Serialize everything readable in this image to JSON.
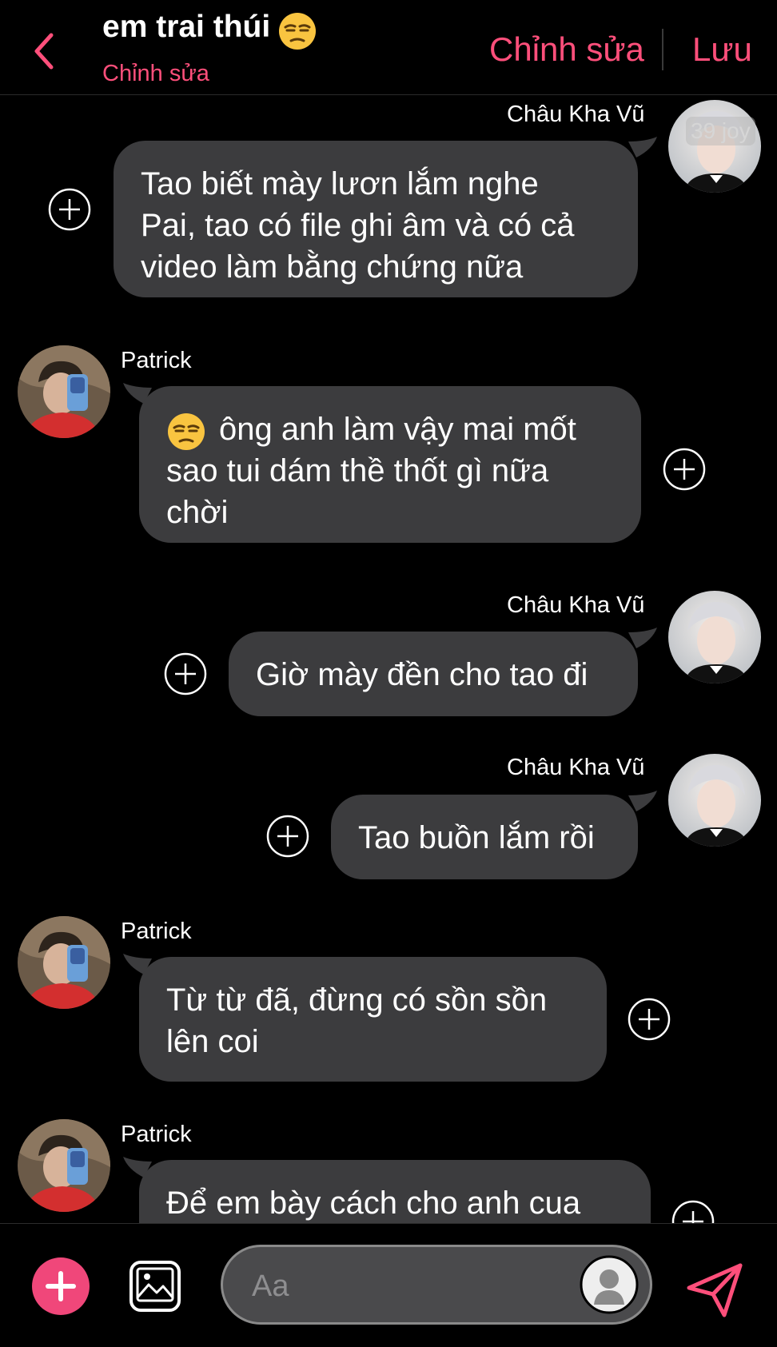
{
  "header": {
    "title": "em trai thúi",
    "subtitle": "Chỉnh sửa",
    "edit_label": "Chỉnh sửa",
    "save_label": "Lưu"
  },
  "watermark": "39 joy",
  "messages": [
    {
      "sender": "Châu Kha Vũ",
      "text": "Tao biết mày lươn lắm nghe\nPai, tao có file ghi âm và có cả\nvideo làm bằng chứng nữa"
    },
    {
      "sender": "Patrick",
      "text": "ông anh làm vậy mai mốt\nsao tui dám thề thốt gì nữa\nchời"
    },
    {
      "sender": "Châu Kha Vũ",
      "text": "Giờ mày đền cho tao đi"
    },
    {
      "sender": "Châu Kha Vũ",
      "text": "Tao buồn lắm rồi"
    },
    {
      "sender": "Patrick",
      "text": "Từ từ đã, đừng có sồn sồn\nlên coi"
    },
    {
      "sender": "Patrick",
      "text": "Để em bày cách cho anh cua"
    }
  ],
  "composer": {
    "placeholder": "Aa"
  },
  "colors": {
    "accent": "#ff4f7b",
    "bubble": "#3c3c3e",
    "background": "#000000",
    "add_button": "#f0477a"
  }
}
